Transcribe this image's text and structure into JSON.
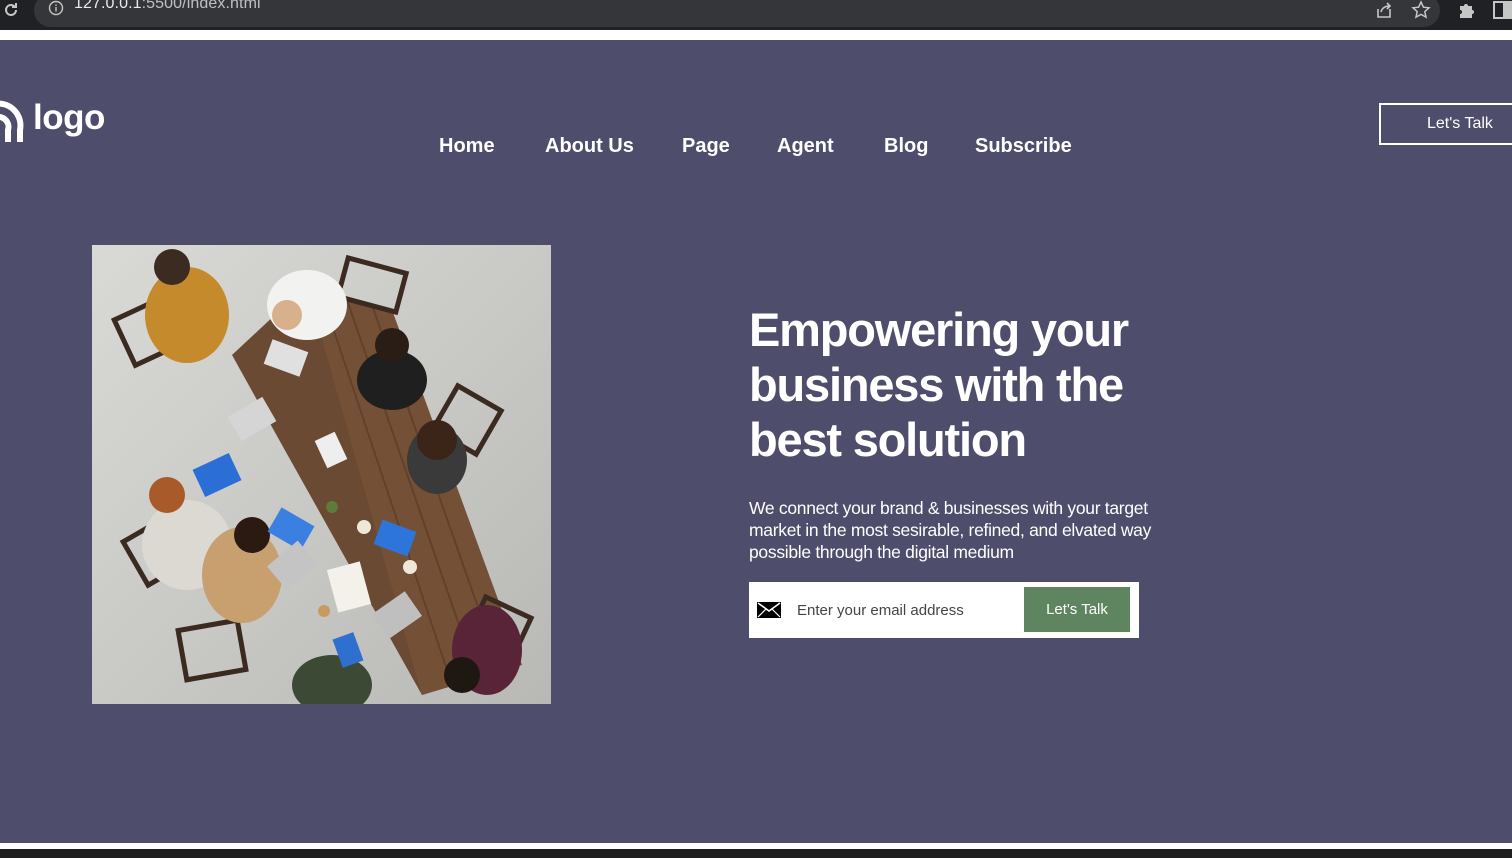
{
  "browser": {
    "url_host": "127.0.0.1",
    "url_path": ":5500/index.html",
    "icons": [
      "reload-icon",
      "info-icon",
      "share-icon",
      "star-icon",
      "puzzle-icon",
      "side-panel-icon"
    ]
  },
  "header": {
    "logo_text": "logo",
    "nav": [
      {
        "label": "Home"
      },
      {
        "label": "About Us"
      },
      {
        "label": "Page"
      },
      {
        "label": "Agent"
      },
      {
        "label": "Blog"
      },
      {
        "label": "Subscribe"
      }
    ],
    "cta_label": "Let's Talk"
  },
  "hero": {
    "headline": "Empowering your business with the best solution",
    "subtext": "We connect your brand & businesses with your target market in the most sesirable, refined, and elvated way possible through the digital medium",
    "email_placeholder": "Enter your email address",
    "email_value": "",
    "submit_label": "Let's Talk",
    "image": "team-meeting-photo"
  },
  "colors": {
    "page_background": "#4e4d6b",
    "button_green": "#5e8560",
    "text": "#ffffff"
  }
}
